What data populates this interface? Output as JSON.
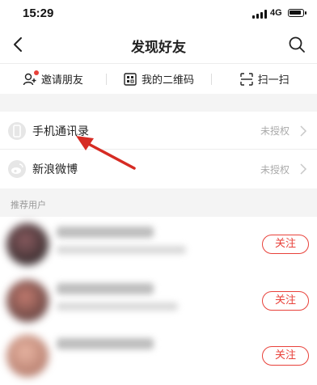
{
  "status_bar": {
    "time": "15:29",
    "network": "4G"
  },
  "nav": {
    "title": "发现好友"
  },
  "tabs": [
    {
      "label": "邀请朋友",
      "icon": "person-add-icon"
    },
    {
      "label": "我的二维码",
      "icon": "qr-code-icon"
    },
    {
      "label": "扫一扫",
      "icon": "scan-icon"
    }
  ],
  "sources": [
    {
      "label": "手机通讯录",
      "status": "未授权",
      "icon": "phone-icon"
    },
    {
      "label": "新浪微博",
      "status": "未授权",
      "icon": "weibo-icon"
    }
  ],
  "recommended": {
    "header": "推荐用户",
    "follow_label": "关注"
  },
  "colors": {
    "accent": "#e8413a",
    "annotation": "#d62b23"
  }
}
